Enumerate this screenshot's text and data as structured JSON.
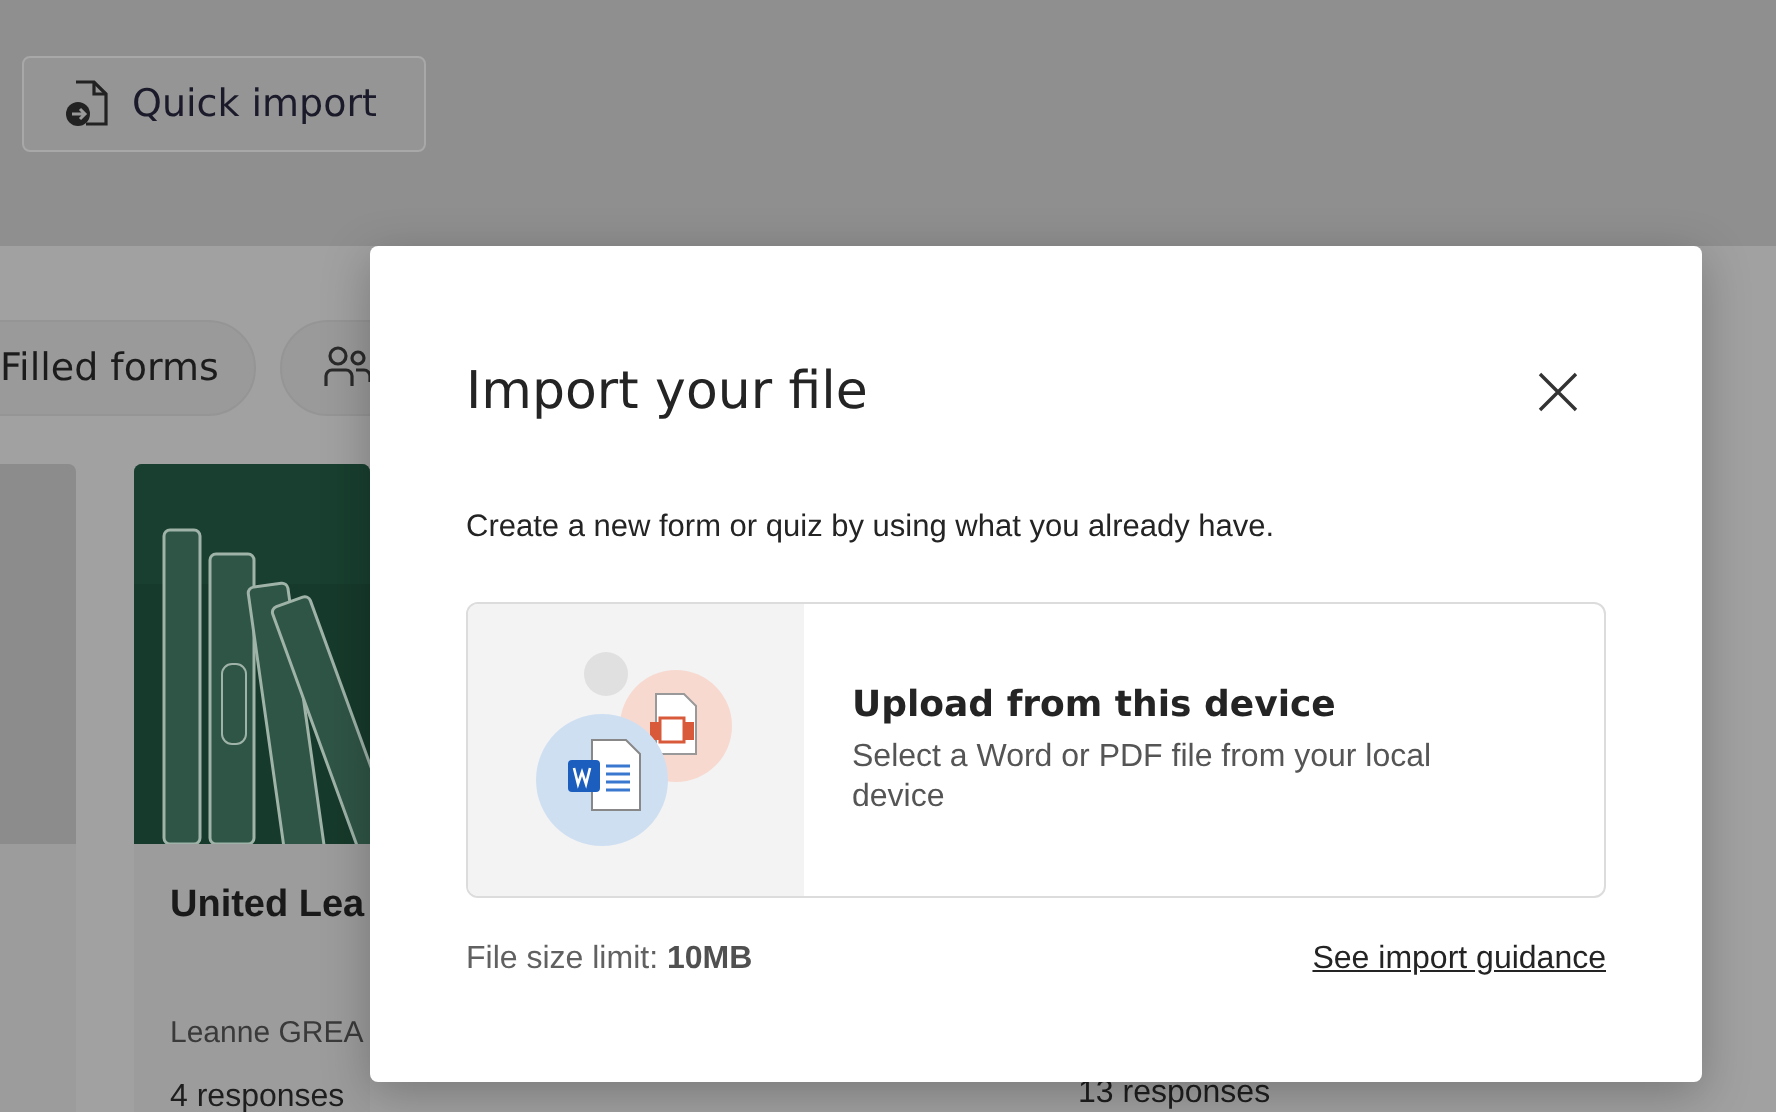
{
  "toolbar": {
    "quick_import_button": "Quick import"
  },
  "filters": [
    {
      "kind": "text",
      "label": "Filled forms"
    },
    {
      "kind": "people"
    }
  ],
  "cards": [
    {
      "kind": "blank"
    },
    {
      "kind": "picture",
      "title": "United Lea",
      "owner": "Leanne GREA",
      "responses": "4 responses"
    },
    {
      "kind": "covered",
      "responses": "13 responses"
    }
  ],
  "dialog": {
    "title": "Import your file",
    "description": "Create a new form or quiz by using what you already have.",
    "option": {
      "title": "Upload from this device",
      "subtitle": "Select a Word or PDF file from your local device"
    },
    "size_limit": "File size limit: **10MB**",
    "guidance_link": "See import guidance"
  }
}
